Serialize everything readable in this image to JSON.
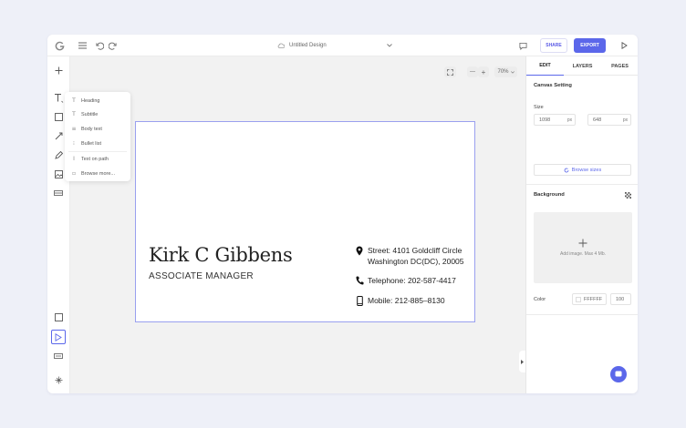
{
  "topbar": {
    "title": "Untitled Design",
    "share_label": "SHARE",
    "export_label": "EXPORT"
  },
  "text_menu": {
    "items": [
      {
        "label": "Heading",
        "icon": "heading-icon"
      },
      {
        "label": "Subtitle",
        "icon": "subtitle-icon"
      },
      {
        "label": "Body text",
        "icon": "body-text-icon"
      },
      {
        "label": "Bullet list",
        "icon": "bullet-list-icon"
      },
      {
        "label": "Text on path",
        "icon": "text-path-icon"
      },
      {
        "label": "Browse more...",
        "icon": "browse-icon"
      }
    ]
  },
  "zoom": {
    "minus": "—",
    "plus": "+",
    "level": "70%"
  },
  "card": {
    "name": "Kirk C Gibbens",
    "role": "ASSOCIATE MANAGER",
    "street": "Street: 4101 Goldcliff Circle",
    "city": "Washington DC(DC), 20005",
    "telephone": "Telephone: 202-587-4417",
    "mobile": "Mobile: 212-885–8130"
  },
  "panel": {
    "tabs": [
      "EDIT",
      "LAYERS",
      "PAGES"
    ],
    "canvas_setting": "Canvas Setting",
    "size_label": "Size",
    "width": "1098",
    "width_unit": "px",
    "height": "648",
    "height_unit": "px",
    "browse_sizes": "Browse sizes",
    "background_label": "Background",
    "add_image": "Add image. Max 4 Mb.",
    "color_label": "Color",
    "color_value": "FFFFFF",
    "opacity_value": "100"
  },
  "colors": {
    "accent": "#5b67ea",
    "card_border": "#9aa0ef"
  }
}
